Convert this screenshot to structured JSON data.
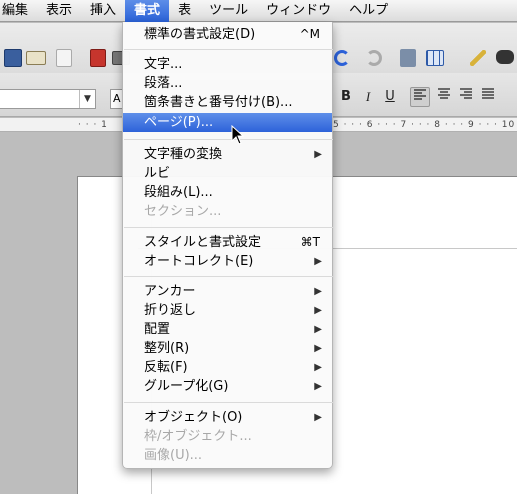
{
  "menubar": {
    "items": [
      {
        "label": "編集",
        "active": false
      },
      {
        "label": "表示",
        "active": false
      },
      {
        "label": "挿入",
        "active": false
      },
      {
        "label": "書式",
        "active": true
      },
      {
        "label": "表",
        "active": false
      },
      {
        "label": "ツール",
        "active": false
      },
      {
        "label": "ウィンドウ",
        "active": false
      },
      {
        "label": "ヘルプ",
        "active": false
      }
    ]
  },
  "toolbar": {
    "font_size_value": "A",
    "bold_label": "B",
    "italic_label": "I",
    "underline_label": "U"
  },
  "ruler": {
    "left_text": "· · · 1",
    "right_text": "5 · · · 6 · · · 7 · · · 8 · · · 9 · · · 10"
  },
  "format_menu": {
    "items": [
      {
        "label": "標準の書式設定(D)",
        "shortcut": "^M"
      },
      {
        "label": "文字..."
      },
      {
        "label": "段落..."
      },
      {
        "label": "箇条書きと番号付け(B)..."
      },
      {
        "label": "ページ(P)..."
      },
      {
        "label": "文字種の変換"
      },
      {
        "label": "ルビ"
      },
      {
        "label": "段組み(L)..."
      },
      {
        "label": "セクション..."
      },
      {
        "label": "スタイルと書式設定",
        "shortcut": "⌘T"
      },
      {
        "label": "オートコレクト(E)"
      },
      {
        "label": "アンカー"
      },
      {
        "label": "折り返し"
      },
      {
        "label": "配置"
      },
      {
        "label": "整列(R)"
      },
      {
        "label": "反転(F)"
      },
      {
        "label": "グループ化(G)"
      },
      {
        "label": "オブジェクト(O)"
      },
      {
        "label": "枠/オブジェクト..."
      },
      {
        "label": "画像(U)..."
      }
    ],
    "submenu_arrow": "▶"
  },
  "colors": {
    "selection": "#2d62d9",
    "menubar_bg": "#e8e8e8",
    "disabled_text": "#a8a8a8"
  }
}
